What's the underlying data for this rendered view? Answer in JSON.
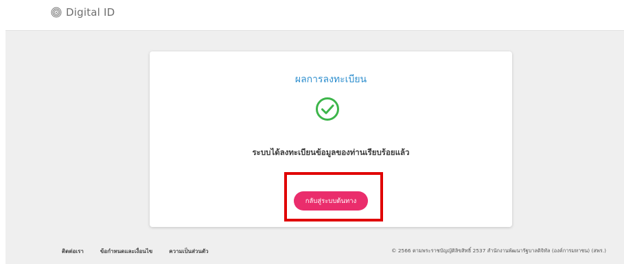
{
  "header": {
    "brand": "Digital ID",
    "logo_icon": "fingerprint-icon"
  },
  "card": {
    "title": "ผลการลงทะเบียน",
    "icon": "check-circle-icon",
    "message": "ระบบได้ลงทะเบียนข้อมูลของท่านเรียบร้อยแล้ว",
    "button_label": "กลับสู่ระบบต้นทาง"
  },
  "footer": {
    "links": [
      "ติดต่อเรา",
      "ข้อกำหนดและเงื่อนไข",
      "ความเป็นส่วนตัว"
    ],
    "copyright": "© 2566 ตามพระราชบัญญัติลิขสิทธิ์ 2537 สำนักงานพัฒนารัฐบาลดิจิทัล (องค์การมหาชน) (สพร.)"
  },
  "colors": {
    "accent_blue": "#2f8fce",
    "success_green": "#3cb54a",
    "button_pink": "#ea2d6c",
    "highlight_red": "#e00000"
  }
}
